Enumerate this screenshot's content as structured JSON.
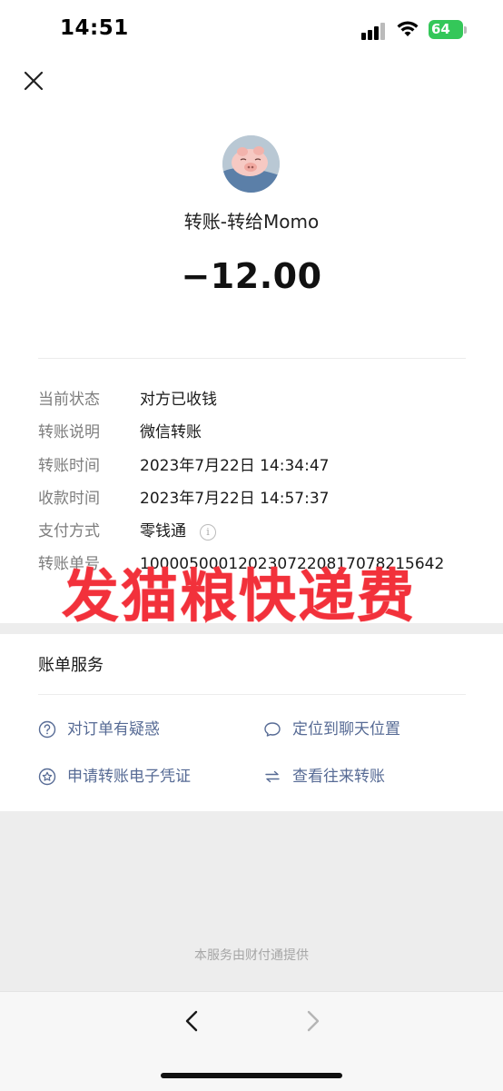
{
  "status_bar": {
    "time": "14:51",
    "battery": "64"
  },
  "header": {
    "close_icon": "close-icon"
  },
  "transfer": {
    "title": "转账-转给Momo",
    "amount": "−12.00"
  },
  "details": [
    {
      "label": "当前状态",
      "value": "对方已收钱"
    },
    {
      "label": "转账说明",
      "value": "微信转账"
    },
    {
      "label": "转账时间",
      "value": "2023年7月22日 14:34:47"
    },
    {
      "label": "收款时间",
      "value": "2023年7月22日 14:57:37"
    },
    {
      "label": "支付方式",
      "value": "零钱通"
    },
    {
      "label": "转账单号",
      "value": "10000500012023072208170782156​42"
    }
  ],
  "watermark": "发猫粮快递费",
  "services": {
    "title": "账单服务",
    "items": [
      {
        "label": "对订单有疑惑",
        "icon": "question-circle-icon"
      },
      {
        "label": "定位到聊天位置",
        "icon": "chat-bubble-icon"
      },
      {
        "label": "申请转账电子凭证",
        "icon": "star-badge-icon"
      },
      {
        "label": "查看往来转账",
        "icon": "exchange-arrows-icon"
      }
    ]
  },
  "footer": {
    "note": "本服务由财付通提供"
  },
  "colors": {
    "link": "#576b95",
    "watermark": "#f2313b",
    "battery": "#34c759"
  }
}
